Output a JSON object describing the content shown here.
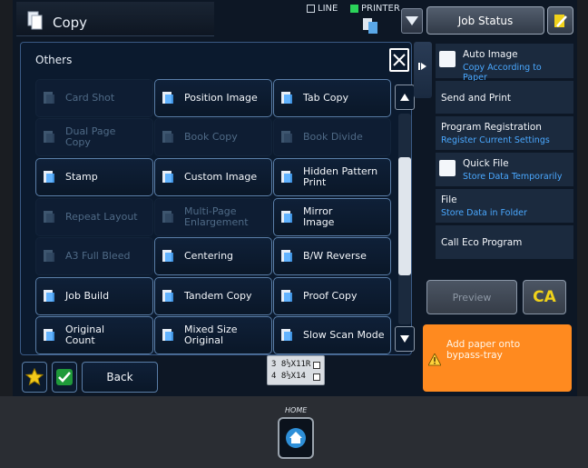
{
  "header": {
    "title": "Copy",
    "line_label": "LINE",
    "printer_label": "PRINTER",
    "job_status_label": "Job Status"
  },
  "others": {
    "title": "Others",
    "buttons": [
      {
        "label": "Card Shot",
        "enabled": false,
        "icon": "card-shot-icon"
      },
      {
        "label": "Position Image",
        "enabled": true,
        "icon": "position-image-icon"
      },
      {
        "label": "Tab Copy",
        "enabled": true,
        "icon": "tab-copy-icon"
      },
      {
        "label": "Dual Page\nCopy",
        "enabled": false,
        "icon": "dual-page-copy-icon"
      },
      {
        "label": "Book Copy",
        "enabled": false,
        "icon": "book-copy-icon"
      },
      {
        "label": "Book Divide",
        "enabled": false,
        "icon": "book-divide-icon"
      },
      {
        "label": "Stamp",
        "enabled": true,
        "icon": "stamp-icon"
      },
      {
        "label": "Custom Image",
        "enabled": true,
        "icon": "custom-image-icon"
      },
      {
        "label": "Hidden Pattern\nPrint",
        "enabled": true,
        "icon": "hidden-pattern-icon"
      },
      {
        "label": "Repeat Layout",
        "enabled": false,
        "icon": "repeat-layout-icon"
      },
      {
        "label": "Multi-Page\nEnlargement",
        "enabled": false,
        "icon": "multi-page-icon"
      },
      {
        "label": "Mirror\nImage",
        "enabled": true,
        "icon": "mirror-image-icon"
      },
      {
        "label": "A3 Full Bleed",
        "enabled": false,
        "icon": "full-bleed-icon"
      },
      {
        "label": "Centering",
        "enabled": true,
        "icon": "centering-icon"
      },
      {
        "label": "B/W Reverse",
        "enabled": true,
        "icon": "bw-reverse-icon"
      },
      {
        "label": "Job Build",
        "enabled": true,
        "icon": "job-build-icon"
      },
      {
        "label": "Tandem Copy",
        "enabled": true,
        "icon": "tandem-copy-icon"
      },
      {
        "label": "Proof Copy",
        "enabled": true,
        "icon": "proof-copy-icon"
      },
      {
        "label": "Original\nCount",
        "enabled": true,
        "icon": "original-count-icon"
      },
      {
        "label": "Mixed Size\nOriginal",
        "enabled": true,
        "icon": "mixed-size-icon"
      },
      {
        "label": "Slow Scan Mode",
        "enabled": true,
        "icon": "slow-scan-icon"
      }
    ]
  },
  "bottom": {
    "back_label": "Back"
  },
  "paper": {
    "tray3": "3 8½X11R",
    "tray4": "4 8½X14"
  },
  "side": {
    "items": [
      {
        "title": "Auto Image",
        "sub": "Copy According to Paper",
        "check": true
      },
      {
        "title": "Send and Print",
        "sub": "",
        "check": false
      },
      {
        "title": "Program Registration",
        "sub": "Register Current Settings",
        "check": false
      },
      {
        "title": "Quick File",
        "sub": "Store Data Temporarily",
        "check": true
      },
      {
        "title": "File",
        "sub": "Store Data in Folder",
        "check": false
      },
      {
        "title": "Call Eco Program",
        "sub": "",
        "check": false
      }
    ],
    "preview_label": "Preview",
    "ca_label": "CA",
    "alert_text": "Add paper onto\nbypass-tray"
  },
  "home": {
    "label": "HOME"
  },
  "colors": {
    "accent_blue": "#4aa8ff",
    "alert_orange": "#ff8a1f",
    "ca_yellow": "#f0d21a"
  }
}
